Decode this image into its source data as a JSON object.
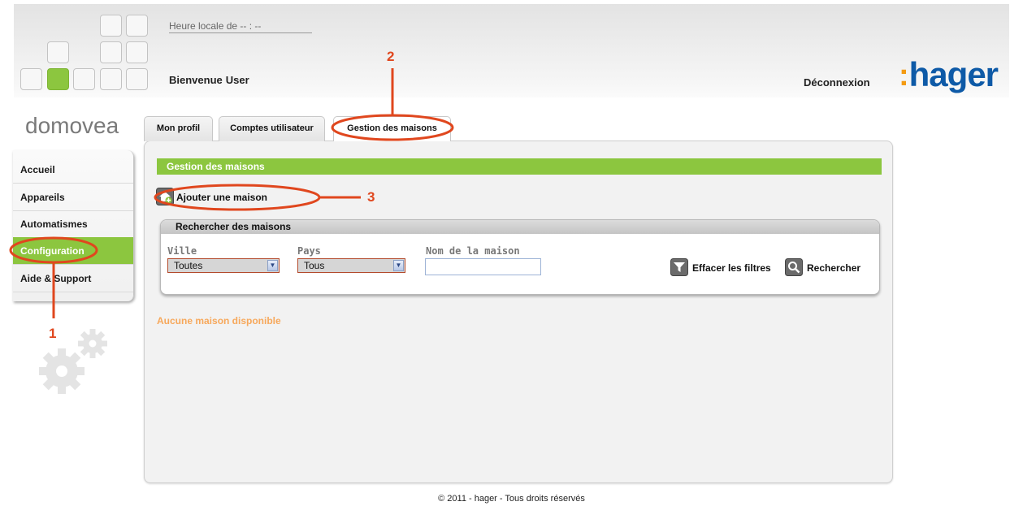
{
  "header": {
    "clock_label": "Heure locale de -- : --",
    "welcome": "Bienvenue",
    "user": "User",
    "logout": "Déconnexion",
    "logo": "hager",
    "logo_colon": ":"
  },
  "brand": "domovea",
  "sidebar": {
    "items": [
      {
        "label": "Accueil"
      },
      {
        "label": "Appareils"
      },
      {
        "label": "Automatismes"
      },
      {
        "label": "Configuration"
      },
      {
        "label": "Aide & Support"
      }
    ]
  },
  "tabs": [
    {
      "label": "Mon profil"
    },
    {
      "label": "Comptes utilisateur"
    },
    {
      "label": "Gestion des maisons"
    }
  ],
  "main": {
    "section_title": "Gestion des maisons",
    "add_house": "Ajouter une maison",
    "search": {
      "title": "Rechercher des maisons",
      "city_label": "Ville",
      "city_value": "Toutes",
      "country_label": "Pays",
      "country_value": "Tous",
      "name_label": "Nom de la maison",
      "name_value": "",
      "clear_filters": "Effacer les filtres",
      "search_button": "Rechercher"
    },
    "empty_message": "Aucune maison disponible"
  },
  "footer": "© 2011 - hager - Tous droits réservés",
  "annotations": [
    "1",
    "2",
    "3"
  ],
  "colors": {
    "accent": "#8cc63f",
    "annotation": "#e0471e",
    "logo": "#0e5aa7",
    "empty_text": "#f7a85b"
  }
}
